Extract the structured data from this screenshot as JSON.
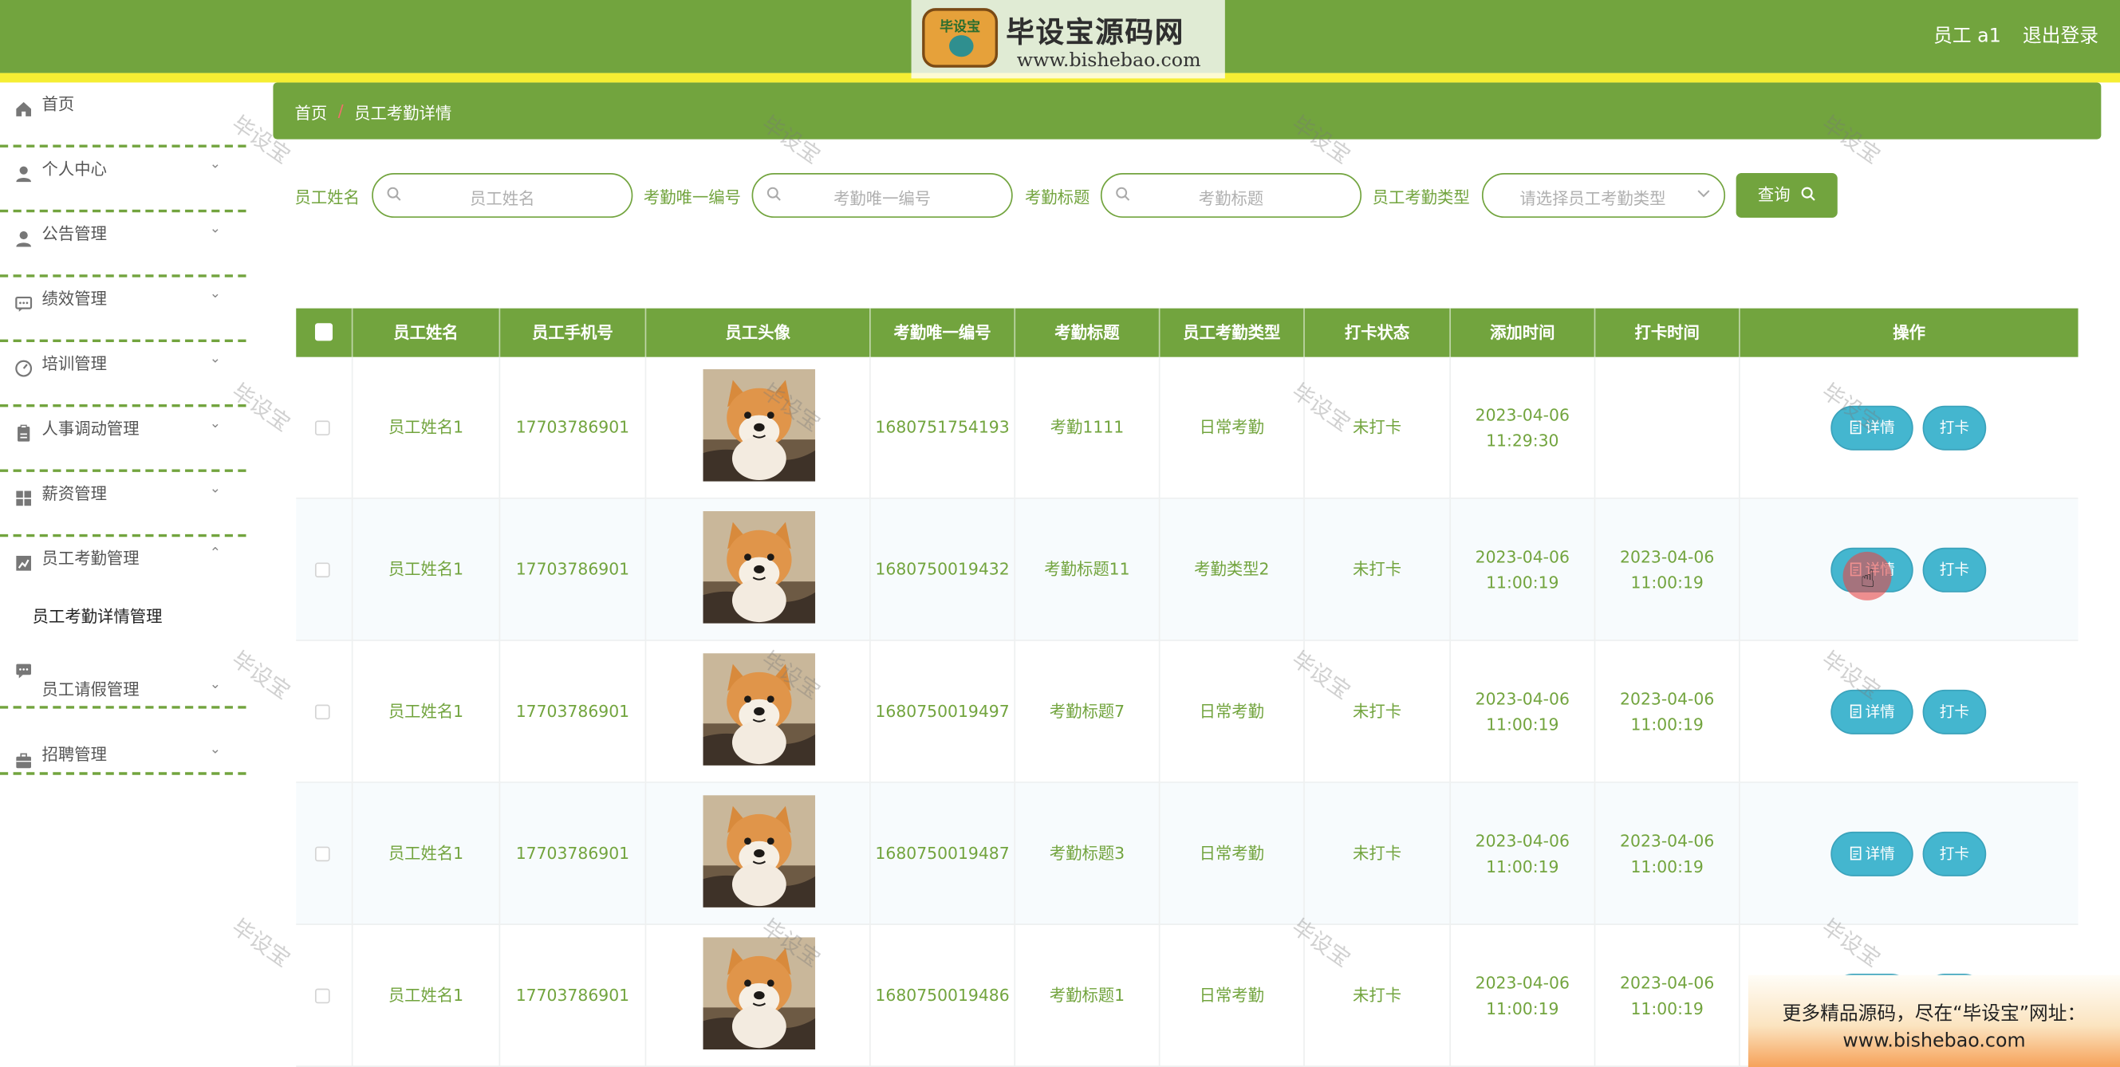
{
  "logo": {
    "badge_text": "毕设宝",
    "title": "毕设宝源码网",
    "url": "www.bishebao.com"
  },
  "header": {
    "user_label": "员工 a1",
    "logout_label": "退出登录"
  },
  "sidebar": {
    "items": [
      {
        "label": "首页",
        "icon": "home-icon",
        "chevron": ""
      },
      {
        "label": "个人中心",
        "icon": "user-icon",
        "chevron": "⌄"
      },
      {
        "label": "公告管理",
        "icon": "user-icon",
        "chevron": "⌄"
      },
      {
        "label": "绩效管理",
        "icon": "chat-icon",
        "chevron": "⌄"
      },
      {
        "label": "培训管理",
        "icon": "gauge-icon",
        "chevron": "⌄"
      },
      {
        "label": "人事调动管理",
        "icon": "clipboard-icon",
        "chevron": "⌄"
      },
      {
        "label": "薪资管理",
        "icon": "grid-icon",
        "chevron": "⌄"
      },
      {
        "label": "员工考勤管理",
        "icon": "chart-icon",
        "chevron": "⌃"
      },
      {
        "label": "员工请假管理",
        "icon": "chat-icon",
        "chevron": "⌄"
      },
      {
        "label": "招聘管理",
        "icon": "briefcase-icon",
        "chevron": "⌄"
      }
    ],
    "sub_item": "员工考勤详情管理"
  },
  "breadcrumb": {
    "home": "首页",
    "separator": "/",
    "current": "员工考勤详情"
  },
  "search": {
    "fields": [
      {
        "label": "员工姓名",
        "placeholder": "员工姓名"
      },
      {
        "label": "考勤唯一编号",
        "placeholder": "考勤唯一编号"
      },
      {
        "label": "考勤标题",
        "placeholder": "考勤标题"
      },
      {
        "label": "员工考勤类型",
        "placeholder": "请选择员工考勤类型"
      }
    ],
    "button_label": "查询"
  },
  "table": {
    "headers": [
      "员工姓名",
      "员工手机号",
      "员工头像",
      "考勤唯一编号",
      "考勤标题",
      "员工考勤类型",
      "打卡状态",
      "添加时间",
      "打卡时间",
      "操作"
    ],
    "rows": [
      {
        "name": "员工姓名1",
        "phone": "17703786901",
        "code": "1680751754193",
        "title": "考勤1111",
        "type": "日常考勤",
        "status": "未打卡",
        "added": "2023-04-06 11:29:30",
        "punched": ""
      },
      {
        "name": "员工姓名1",
        "phone": "17703786901",
        "code": "1680750019432",
        "title": "考勤标题11",
        "type": "考勤类型2",
        "status": "未打卡",
        "added": "2023-04-06 11:00:19",
        "punched": "2023-04-06 11:00:19"
      },
      {
        "name": "员工姓名1",
        "phone": "17703786901",
        "code": "1680750019497",
        "title": "考勤标题7",
        "type": "日常考勤",
        "status": "未打卡",
        "added": "2023-04-06 11:00:19",
        "punched": "2023-04-06 11:00:19"
      },
      {
        "name": "员工姓名1",
        "phone": "17703786901",
        "code": "1680750019487",
        "title": "考勤标题3",
        "type": "日常考勤",
        "status": "未打卡",
        "added": "2023-04-06 11:00:19",
        "punched": "2023-04-06 11:00:19"
      },
      {
        "name": "员工姓名1",
        "phone": "17703786901",
        "code": "1680750019486",
        "title": "考勤标题1",
        "type": "日常考勤",
        "status": "未打卡",
        "added": "2023-04-06 11:00:19",
        "punched": "2023-04-06 11:00:19"
      }
    ],
    "detail_label": "详情",
    "punch_label": "打卡"
  },
  "watermark_text": "毕设宝",
  "promo": {
    "line1": "更多精品源码，尽在“毕设宝”网址：",
    "line2": "www.bishebao.com"
  },
  "colors": {
    "primary": "#72a43e",
    "accent_stripe": "#f5ee33",
    "action_button": "#44b6cf"
  }
}
